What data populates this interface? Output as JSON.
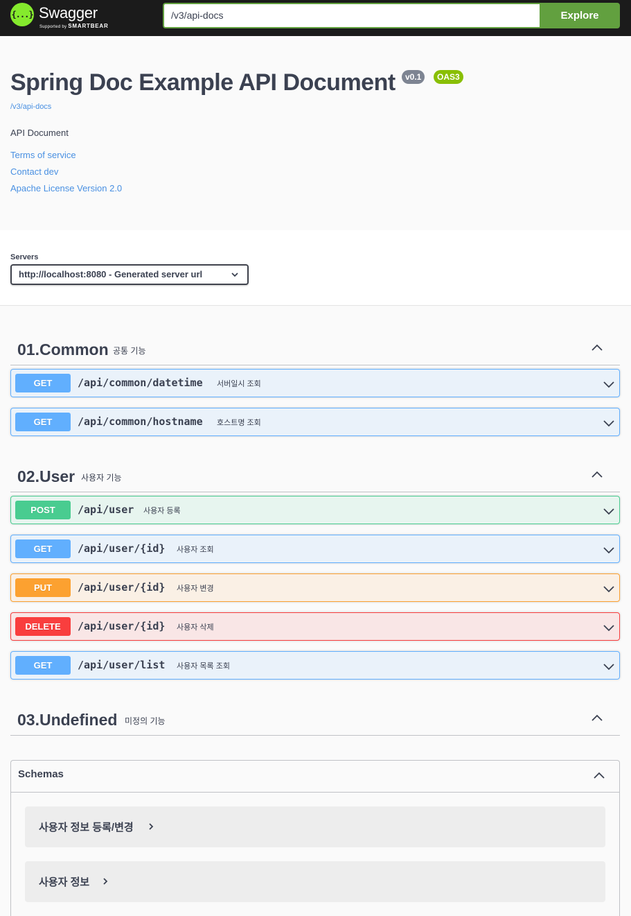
{
  "topbar": {
    "logo_mark": "{...}",
    "logo_title": "Swagger",
    "logo_sub_prefix": "Supported by",
    "logo_sub_brand": "SMARTBEAR",
    "url_value": "/v3/api-docs",
    "explore_label": "Explore"
  },
  "info": {
    "title": "Spring Doc Example API Document",
    "version_badge": "v0.1",
    "oas_badge": "OAS3",
    "url": "/v3/api-docs",
    "description": "API Document",
    "links": [
      "Terms of service",
      "Contact dev",
      "Apache License Version 2.0"
    ]
  },
  "servers": {
    "label": "Servers",
    "selected": "http://localhost:8080 - Generated server url"
  },
  "tags": [
    {
      "name": "01.Common",
      "description": "공통 기능"
    },
    {
      "name": "02.User",
      "description": "사용자 기능"
    },
    {
      "name": "03.Undefined",
      "description": "미정의 기능"
    }
  ],
  "operations": [
    {
      "method": "GET",
      "path": "/api/common/datetime",
      "summary": "서버일시 조회"
    },
    {
      "method": "GET",
      "path": "/api/common/hostname",
      "summary": "호스트명 조회"
    },
    {
      "method": "POST",
      "path": "/api/user",
      "summary": "사용자 등록"
    },
    {
      "method": "GET",
      "path": "/api/user/{id}",
      "summary": "사용자 조회"
    },
    {
      "method": "PUT",
      "path": "/api/user/{id}",
      "summary": "사용자 변경"
    },
    {
      "method": "DELETE",
      "path": "/api/user/{id}",
      "summary": "사용자 삭제"
    },
    {
      "method": "GET",
      "path": "/api/user/list",
      "summary": "사용자 목록 조회"
    }
  ],
  "schemas": {
    "title": "Schemas",
    "models": [
      "사용자 정보 등록/변경",
      "사용자 정보"
    ]
  },
  "colors": {
    "topbar_bg": "#1b1b1b",
    "logo_green": "#85ea2d",
    "explore_green": "#62a03f",
    "get": "#61affe",
    "post": "#49cc90",
    "put": "#fca130",
    "delete": "#f93e3e",
    "link": "#4990e2"
  }
}
